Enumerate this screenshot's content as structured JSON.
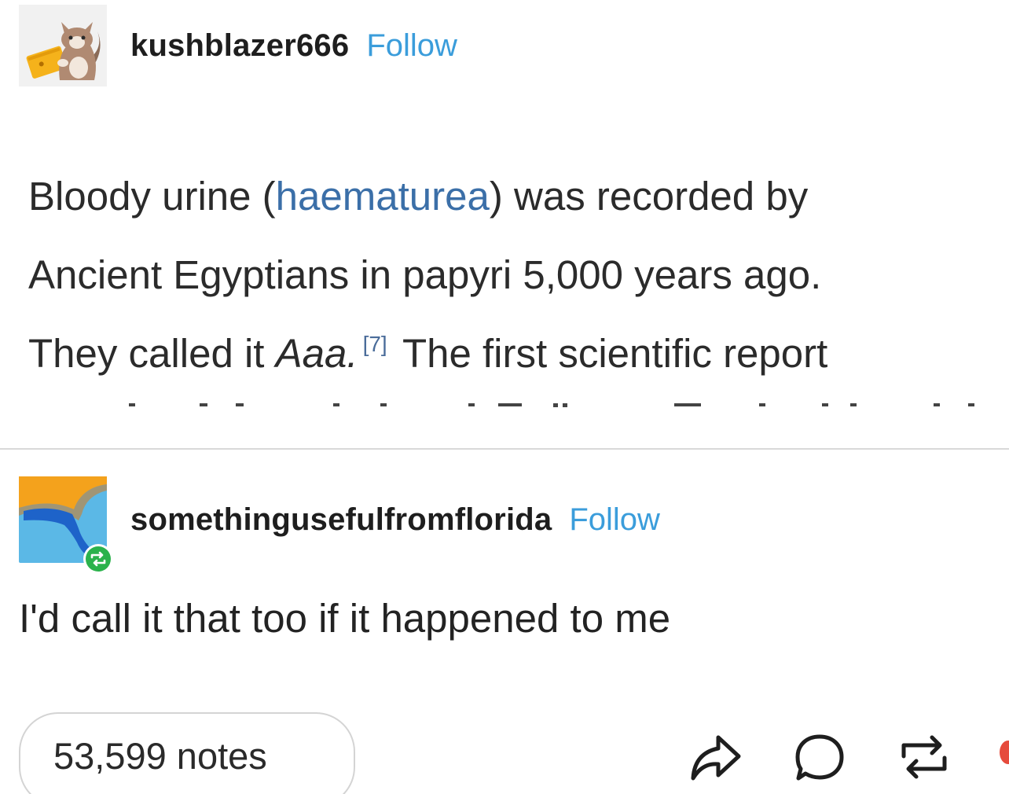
{
  "post": {
    "username": "kushblazer666",
    "follow_label": "Follow",
    "avatar_icon": "cat-with-laptop-avatar",
    "excerpt": {
      "line1_pre": "Bloody urine (",
      "line1_link": "haematurea",
      "line1_post": ") was recorded by",
      "line2": "Ancient Egyptians in papyri 5,000 years ago.",
      "line3_pre": "They called it ",
      "line3_italic": "Aaa.",
      "citation": "[7]",
      "line3_post": " The first scientific report"
    }
  },
  "reply": {
    "username": "somethingusefulfromflorida",
    "follow_label": "Follow",
    "avatar_icon": "florida-map-avatar",
    "badge_icon": "reblog-badge-icon",
    "text": "I'd call it that too if it happened to me"
  },
  "footer": {
    "notes_label": "53,599 notes",
    "icons": [
      "share-icon",
      "reply-icon",
      "reblog-icon"
    ]
  },
  "colors": {
    "follow": "#3b9ddb",
    "link": "#3b6fa8",
    "reblog_badge": "#2bb24c",
    "text": "#222222"
  }
}
